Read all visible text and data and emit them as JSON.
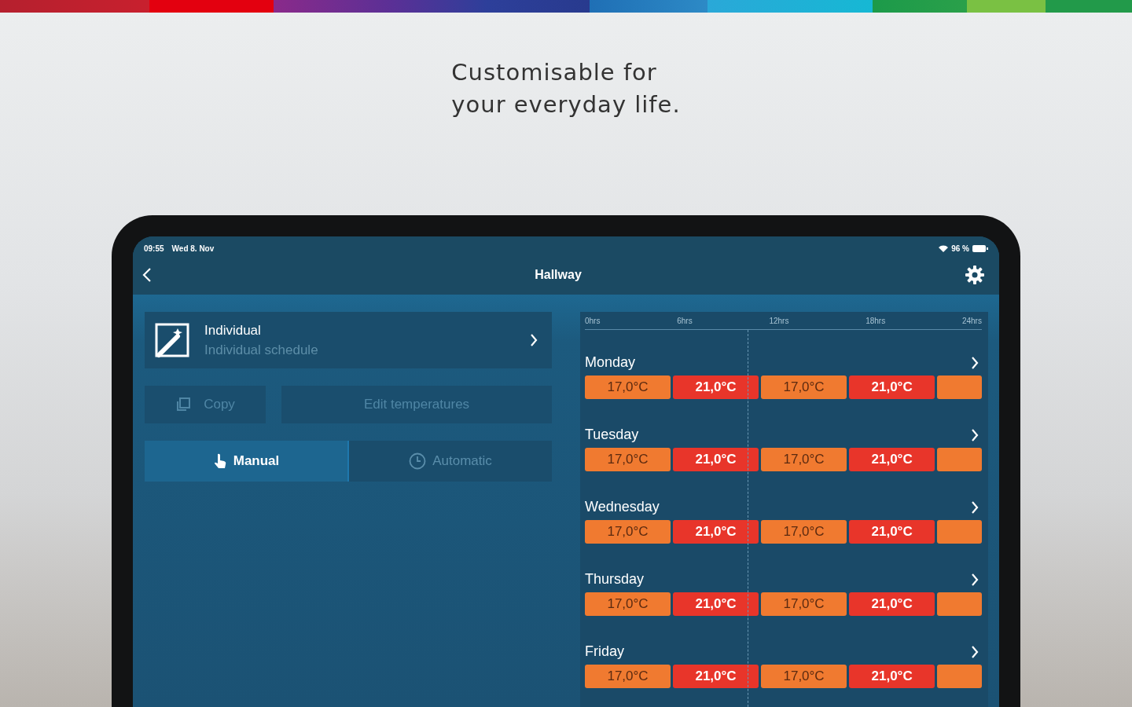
{
  "headline": [
    "Customisable for",
    "your everyday life."
  ],
  "status_bar": {
    "time": "09:55",
    "date": "Wed 8. Nov",
    "battery_text": "96 %"
  },
  "nav": {
    "title": "Hallway"
  },
  "profile": {
    "title": "Individual",
    "subtitle": "Individual schedule"
  },
  "actions": [
    {
      "label": "Copy",
      "kind": "copy",
      "disabled": true
    },
    {
      "label": "Edit temperatures",
      "kind": "plain",
      "disabled": true
    }
  ],
  "modes": [
    {
      "label": "Manual",
      "kind": "hand",
      "selected": true
    },
    {
      "label": "Automatic",
      "kind": "clock",
      "selected": false
    }
  ],
  "schedule": {
    "ticks": [
      "0hrs",
      "6hrs",
      "12hrs",
      "18hrs",
      "24hrs"
    ],
    "now_marker": {
      "level": 0.41
    },
    "days": [
      {
        "name": "Monday",
        "segments": [
          {
            "label": "17,0°C",
            "color": "#f07a30"
          },
          {
            "label": "21,0°C",
            "color": "#e8352a"
          },
          {
            "label": "17,0°C",
            "color": "#f07a30"
          },
          {
            "label": "21,0°C",
            "color": "#e8352a"
          },
          {
            "color": "#f07a30"
          }
        ]
      },
      {
        "name": "Tuesday",
        "segments": [
          {
            "label": "17,0°C",
            "color": "#f07a30"
          },
          {
            "label": "21,0°C",
            "color": "#e8352a"
          },
          {
            "label": "17,0°C",
            "color": "#f07a30"
          },
          {
            "label": "21,0°C",
            "color": "#e8352a"
          },
          {
            "color": "#f07a30"
          }
        ]
      },
      {
        "name": "Wednesday",
        "segments": [
          {
            "label": "17,0°C",
            "color": "#f07a30"
          },
          {
            "label": "21,0°C",
            "color": "#e8352a"
          },
          {
            "label": "17,0°C",
            "color": "#f07a30"
          },
          {
            "label": "21,0°C",
            "color": "#e8352a"
          },
          {
            "color": "#f07a30"
          }
        ]
      },
      {
        "name": "Thursday",
        "segments": [
          {
            "label": "17,0°C",
            "color": "#f07a30"
          },
          {
            "label": "21,0°C",
            "color": "#e8352a"
          },
          {
            "label": "17,0°C",
            "color": "#f07a30"
          },
          {
            "label": "21,0°C",
            "color": "#e8352a"
          },
          {
            "color": "#f07a30"
          }
        ]
      },
      {
        "name": "Friday",
        "segments": [
          {
            "label": "17,0°C",
            "color": "#f07a30"
          },
          {
            "label": "21,0°C",
            "color": "#e8352a"
          },
          {
            "label": "17,0°C",
            "color": "#f07a30"
          },
          {
            "label": "21,0°C",
            "color": "#e8352a"
          },
          {
            "color": "#f07a30"
          }
        ]
      }
    ]
  }
}
